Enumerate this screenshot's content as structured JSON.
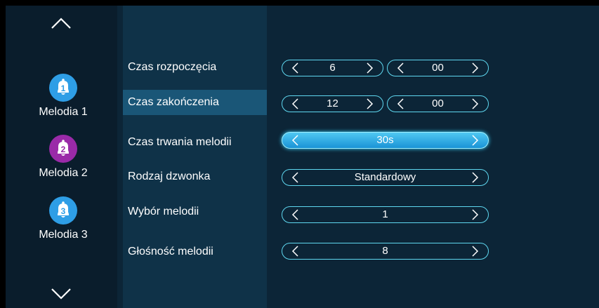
{
  "melodies": [
    {
      "number": "1",
      "label": "Melodia 1",
      "color": "#2e9ee6"
    },
    {
      "number": "2",
      "label": "Melodia 2",
      "color": "#9a2aa8"
    },
    {
      "number": "3",
      "label": "Melodia 3",
      "color": "#2e9ee6"
    }
  ],
  "rows": [
    {
      "label": "Czas rozpoczęcia"
    },
    {
      "label": "Czas zakończenia"
    },
    {
      "label": "Czas trwania melodii"
    },
    {
      "label": "Rodzaj dzwonka"
    },
    {
      "label": "Wybór melodii"
    },
    {
      "label": "Głośność melodii"
    }
  ],
  "values": {
    "start_hour": "6",
    "start_minute": "00",
    "end_hour": "12",
    "end_minute": "00",
    "duration": "30s",
    "ring_type": "Standardowy",
    "melody_choice": "1",
    "volume": "8"
  },
  "colors": {
    "accent": "#5fd8f0",
    "active": "#1a93d6",
    "selected_row": "#1a5677"
  },
  "icons": {
    "up": "chevron-up-icon",
    "down": "chevron-down-icon",
    "bell": "bell-icon",
    "left": "chevron-left-icon",
    "right": "chevron-right-icon"
  }
}
